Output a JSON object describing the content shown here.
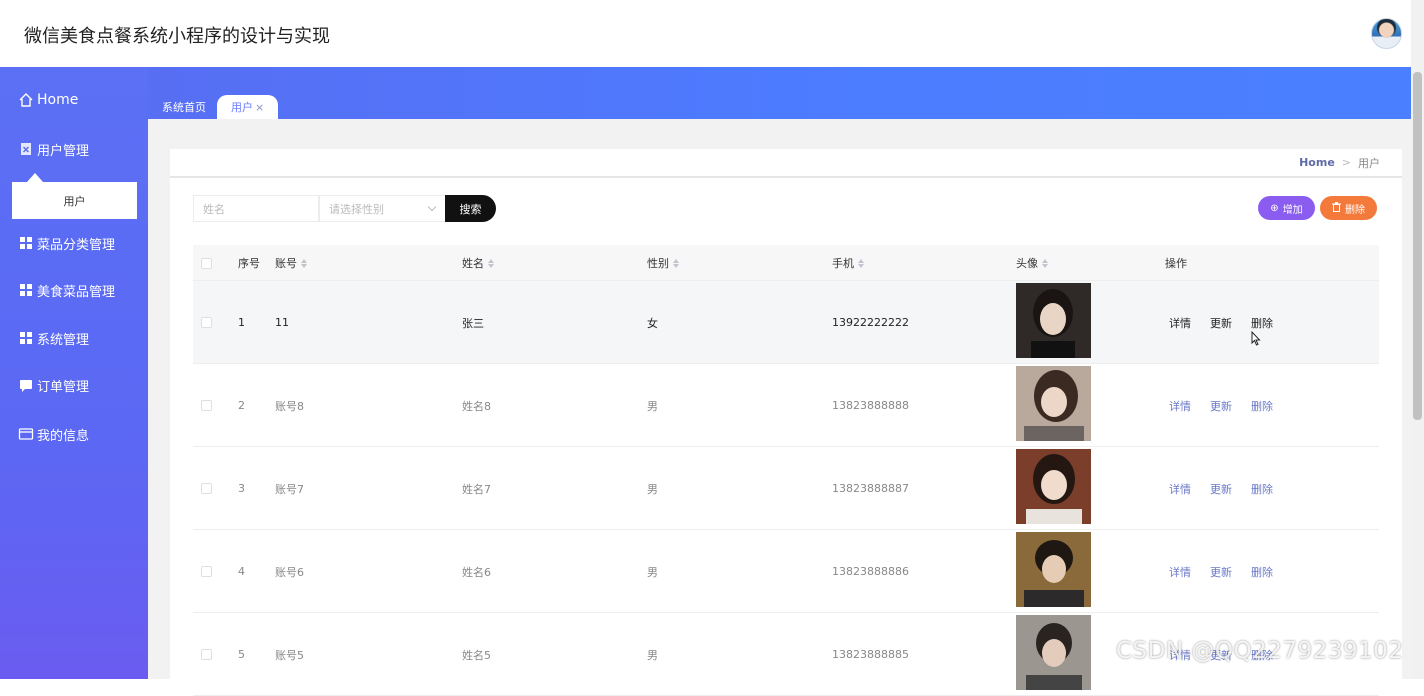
{
  "app": {
    "title": "微信美食点餐系统小程序的设计与实现"
  },
  "sidebar": {
    "home": "Home",
    "user_mgmt": "用户管理",
    "user_sub": "用户",
    "category_mgmt": "菜品分类管理",
    "dish_mgmt": "美食菜品管理",
    "system_mgmt": "系统管理",
    "order_mgmt": "订单管理",
    "my_info": "我的信息"
  },
  "tabs": {
    "home_tab": "系统首页",
    "active_tab": "用户",
    "close": "×"
  },
  "breadcrumb": {
    "home": "Home",
    "sep": ">",
    "current": "用户"
  },
  "search": {
    "name_placeholder": "姓名",
    "gender_placeholder": "请选择性别",
    "search_label": "搜索"
  },
  "actions": {
    "add": "增加",
    "delete": "删除"
  },
  "table": {
    "headers": {
      "index": "序号",
      "account": "账号",
      "name": "姓名",
      "gender": "性别",
      "phone": "手机",
      "avatar": "头像",
      "ops": "操作"
    },
    "ops": {
      "detail": "详情",
      "update": "更新",
      "delete": "删除"
    },
    "rows": [
      {
        "index": "1",
        "account": "11",
        "name": "张三",
        "gender": "女",
        "phone": "13922222222"
      },
      {
        "index": "2",
        "account": "账号8",
        "name": "姓名8",
        "gender": "男",
        "phone": "13823888888"
      },
      {
        "index": "3",
        "account": "账号7",
        "name": "姓名7",
        "gender": "男",
        "phone": "13823888887"
      },
      {
        "index": "4",
        "account": "账号6",
        "name": "姓名6",
        "gender": "男",
        "phone": "13823888886"
      },
      {
        "index": "5",
        "account": "账号5",
        "name": "姓名5",
        "gender": "男",
        "phone": "13823888885"
      }
    ]
  },
  "watermark": "CSDN @QQ2279239102",
  "colors": {
    "sidebar": "#5b70f5",
    "add_button": "#8a5cf0",
    "delete_button": "#f37a3a",
    "action_link": "#6a78c8"
  }
}
